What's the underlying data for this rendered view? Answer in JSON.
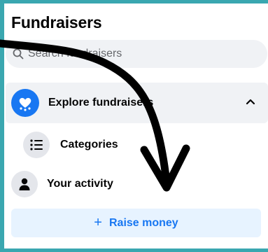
{
  "header": {
    "title": "Fundraisers"
  },
  "search": {
    "placeholder": "Search fundraisers",
    "icon": "search-icon"
  },
  "nav": {
    "explore": {
      "label": "Explore fundraisers",
      "icon": "heart-donate-icon",
      "expanded": true
    },
    "categories": {
      "label": "Categories",
      "icon": "list-icon"
    },
    "activity": {
      "label": "Your activity",
      "icon": "person-icon"
    }
  },
  "actions": {
    "raise_plus": "+",
    "raise_label": "Raise money"
  },
  "colors": {
    "accent": "#1877f2",
    "frame": "#3aa7b0",
    "raise_bg": "#e7f3ff",
    "row_bg": "#f0f2f5"
  }
}
